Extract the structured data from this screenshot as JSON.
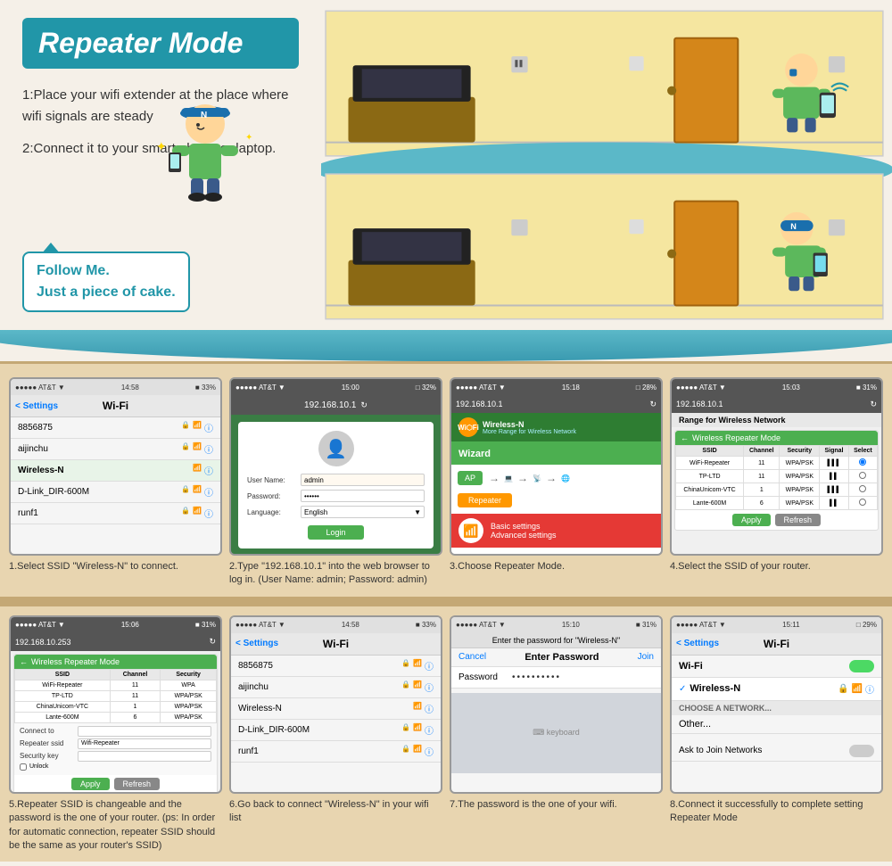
{
  "title": "Repeater Mode",
  "steps": {
    "step1": "1:Place your wifi extender at the place where wifi signals are steady",
    "step2": "2:Connect it to your smart phone or laptop.",
    "follow_me": "Follow Me.\nJust a piece of cake."
  },
  "captions": {
    "cap1": "1.Select SSID \"Wireless-N\" to connect.",
    "cap2": "2.Type \"192.168.10.1\" into the web browser to log in. (User Name: admin; Password: admin)",
    "cap3": "3.Choose Repeater Mode.",
    "cap4": "4.Select the SSID of your router.",
    "cap5": "5.Repeater SSID is changeable and the password is the one of your router. (ps: In order for automatic connection, repeater SSID should be the same as your router's SSID)",
    "cap6": "6.Go back to connect \"Wireless-N\" in your wifi list",
    "cap7": "7.The password is the one of your wifi.",
    "cap8": "8.Connect it successfully to complete setting Repeater Mode"
  },
  "phone1": {
    "status": "●●●●● AT&T ▼   14:58        ■ 33%",
    "nav": "Wi-Fi",
    "back": "< Settings",
    "wifi_items": [
      "8856875",
      "aijinchu",
      "Wireless-N",
      "D-Link_DIR-600M",
      "runf1"
    ]
  },
  "phone2": {
    "status": "●●●●● AT&T ▼   15:00        □ 32%",
    "address": "192.168.10.1",
    "username_label": "User Name:",
    "username_val": "admin",
    "password_label": "Password:",
    "password_val": "••••••",
    "language_label": "Language:",
    "language_val": "English",
    "login_btn": "Login"
  },
  "phone3": {
    "status": "●●●●● AT&T ▼   15:18        □ 28%",
    "address": "192.168.10.1",
    "brand": "Wi⬡Fi",
    "brand2": "Wireless-N",
    "sub": "More Range for Wireless Network",
    "wizard_label": "Wizard",
    "btn_ap": "AP",
    "btn_repeater": "Repeater",
    "basic": "Basic settings",
    "advanced": "Advanced settings"
  },
  "phone4": {
    "status": "●●●●● AT&T ▼   15:03        ■ 31%",
    "address": "192.168.10.1",
    "title": "Range for Wireless Network",
    "header": "Wireless Repeater Mode",
    "ssid_list": [
      {
        "ssid": "WiFi-Repeater",
        "ch": "11",
        "sec": "WPA/PSK",
        "sig": "▌▌▌"
      },
      {
        "ssid": "TP-LTD",
        "ch": "11",
        "sec": "WPA/PSK/AES▌",
        "sig": "▌▌"
      },
      {
        "ssid": "ChinaUnicom-VTC",
        "ch": "1",
        "sec": "WPA/PSK/AES▌",
        "sig": "▌▌▌"
      },
      {
        "ssid": "Lante-600M",
        "ch": "6",
        "sec": "WPA/PSK/AES▌",
        "sig": "▌▌"
      }
    ],
    "apply_btn": "Apply",
    "refresh_btn": "Refresh"
  },
  "phone5": {
    "status": "●●●●● AT&T ▼   15:06        ■ 31%",
    "address": "192.168.10.253",
    "header": "Wireless Repeater Mode",
    "ssid_list": [
      {
        "ssid": "WiFi-Repeater",
        "ch": "11",
        "sec": "WPA"
      },
      {
        "ssid": "TP-LTD",
        "ch": "11",
        "sec": "WPA/PSK/AES"
      },
      {
        "ssid": "ChinaUnicom-VTC",
        "ch": "1",
        "sec": "WPA/PSK/AES"
      },
      {
        "ssid": "Lante-600M",
        "ch": "6",
        "sec": "WPA/PSK/AES"
      }
    ],
    "connect_to": "Connect to",
    "repeater_ssid_label": "Repeater ssid",
    "repeater_ssid_val": "Wifi-Repeater",
    "security_key": "Security key",
    "unlock": "Unlock",
    "apply_btn": "Apply",
    "refresh_btn": "Refresh"
  },
  "phone6": {
    "status": "●●●●● AT&T ▼   14:58        ■ 33%",
    "back": "< Settings",
    "nav": "Wi-Fi",
    "wifi_items": [
      "8856875",
      "aijinchu",
      "Wireless-N",
      "D-Link_DIR-600M",
      "runf1"
    ]
  },
  "phone7": {
    "status": "●●●●● AT&T ▼   15:10        ■ 31%",
    "prompt": "Enter the password for \"Wireless-N\"",
    "cancel": "Cancel",
    "title": "Enter Password",
    "join": "Join",
    "pass_label": "Password",
    "pass_val": "••••••••••"
  },
  "phone8": {
    "status": "●●●●● AT&T ▼   15:11        □ 29%",
    "back": "< Settings",
    "nav": "Wi-Fi",
    "wifi_on": "Wi-Fi",
    "wireless_n": "Wireless-N",
    "choose_network": "CHOOSE A NETWORK...",
    "other": "Other...",
    "ask_join": "Ask to Join Networks"
  },
  "colors": {
    "teal": "#2196a8",
    "green": "#4caf50",
    "orange": "#ff9800",
    "bg_warm": "#f5f0e8",
    "bg_tan": "#e8d5b0",
    "room_yellow": "#f5e6a0"
  }
}
